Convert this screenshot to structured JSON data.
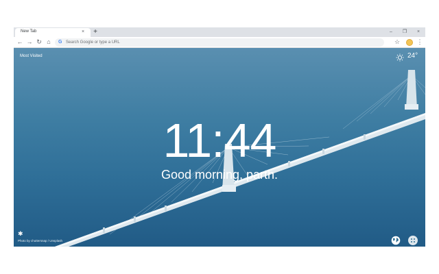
{
  "browser": {
    "tab_title": "New Tab",
    "tab_close": "×",
    "new_tab": "+",
    "window_controls": {
      "minimize": "–",
      "restore": "❐",
      "close": "×"
    },
    "omnibox_placeholder": "Search Google or type a URL",
    "google_letter": "G",
    "nav": {
      "back": "←",
      "forward": "→",
      "reload": "↻",
      "home": "⌂"
    },
    "bookmark_star": "☆",
    "menu": "⋮"
  },
  "page": {
    "most_visited": "Most Visited",
    "temperature": "24°",
    "time": "11:44",
    "greeting": "Good morning, parth.",
    "photo_credit": "Photo by chuttersnap / Unsplash",
    "settings_glyph": "✱"
  },
  "icons": {
    "weather": "sun-icon",
    "settings": "gear-icon",
    "globe": "globe-icon",
    "apps": "apps-grid-icon"
  }
}
